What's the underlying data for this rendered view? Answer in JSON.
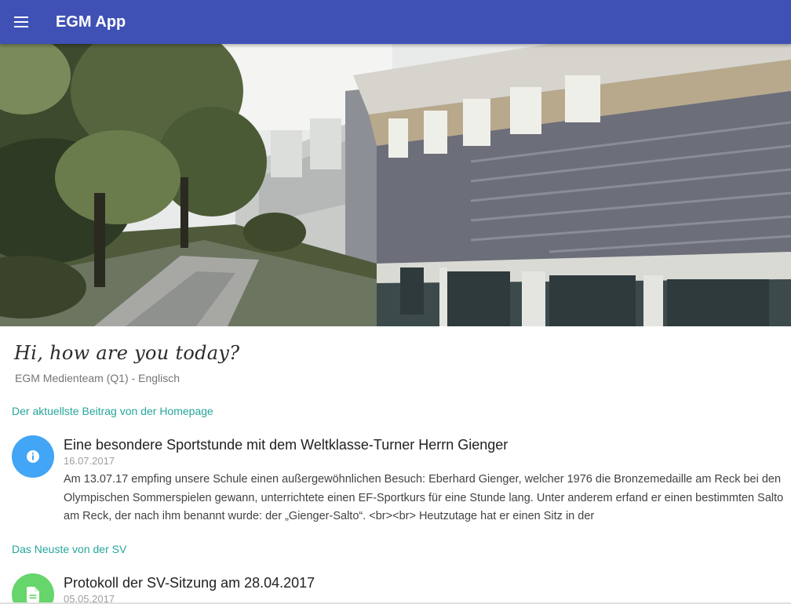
{
  "appbar": {
    "title": "EGM App",
    "menu_icon": "hamburger-menu-icon",
    "background": "#3f51b5"
  },
  "hero": {
    "image": "school-building-illustration"
  },
  "greeting": {
    "text": "Hi, how are you today?",
    "subtitle": "EGM Medienteam (Q1) - Englisch"
  },
  "sections": [
    {
      "header": "Der aktuellste Beitrag von der Homepage",
      "header_color": "#26a69a",
      "post": {
        "icon": "info-icon",
        "icon_color": "#42a5f5",
        "title": "Eine besondere Sportstunde mit dem Weltklasse-Turner Herrn Gienger",
        "date": "16.07.2017",
        "body": "Am 13.07.17 empfing unsere Schule einen außergewöhnlichen Besuch: Eberhard Gienger, welcher 1976 die Bronzemedaille am Reck bei den Olympischen Sommerspielen gewann, unterrichtete einen EF-Sportkurs für eine Stunde lang. Unter anderem erfand er einen bestimmten Salto am Reck, der nach ihm benannt wurde: der „Gienger-Salto“. <br><br> Heutzutage hat er einen Sitz in der"
      }
    },
    {
      "header": "Das Neuste von der SV",
      "header_color": "#26a69a",
      "post": {
        "icon": "document-icon",
        "icon_color": "#66d56b",
        "title": "Protokoll der SV-Sitzung am 28.04.2017",
        "date": "05.05.2017"
      }
    }
  ]
}
